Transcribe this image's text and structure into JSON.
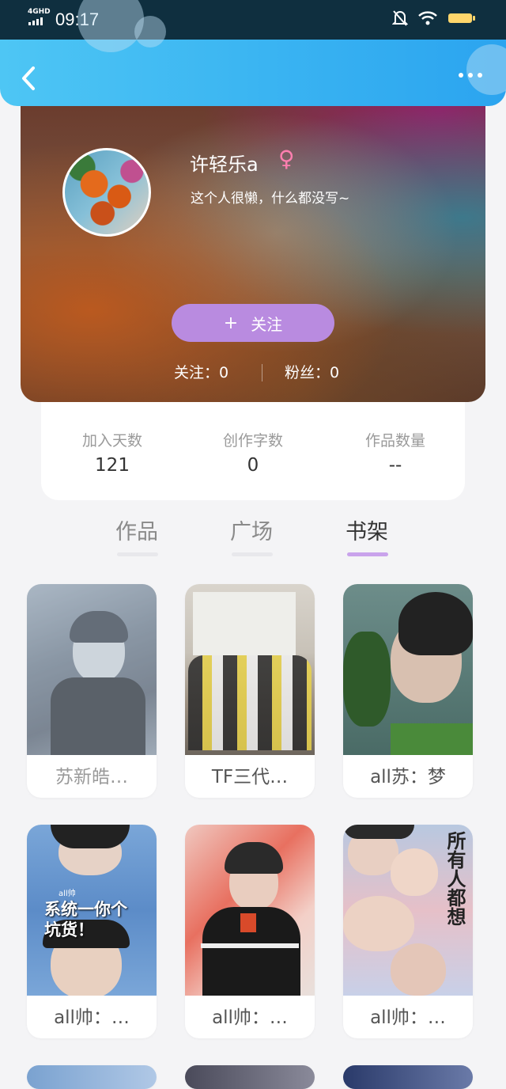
{
  "status_bar": {
    "network": "4GHD",
    "time": "09:17",
    "icons": [
      "signal-icon",
      "bell-muted-icon",
      "wifi-icon",
      "battery-icon"
    ]
  },
  "header": {
    "back_icon": "chevron-left-icon",
    "more_icon": "more-dots-icon"
  },
  "profile": {
    "username": "许轻乐a",
    "gender_symbol": "♀",
    "bio": "这个人很懒，什么都没写~",
    "follow_plus": "+",
    "follow_label": "关注",
    "following": "关注：0",
    "fans": "粉丝：0"
  },
  "stats": [
    {
      "label": "加入天数",
      "value": "121"
    },
    {
      "label": "创作字数",
      "value": "0"
    },
    {
      "label": "作品数量",
      "value": "--"
    }
  ],
  "tabs": [
    {
      "label": "作品",
      "active": false
    },
    {
      "label": "广场",
      "active": false
    },
    {
      "label": "书架",
      "active": true
    }
  ],
  "books": [
    {
      "title": "苏新皓…"
    },
    {
      "title": "TF三代…"
    },
    {
      "title": "all苏：梦"
    },
    {
      "title": "all帅：…"
    },
    {
      "title": "all帅：…"
    },
    {
      "title": "all帅：…"
    }
  ],
  "cover_texts": {
    "book4": "系统一你个坑货！",
    "book4_small": "all帅",
    "book6": "所有人都想"
  },
  "colors": {
    "header_blue": "#3bb5f2",
    "follow_purple": "#b98be0",
    "tab_active_underline": "#c9a3ec",
    "gender_pink": "#ff7fb0"
  }
}
